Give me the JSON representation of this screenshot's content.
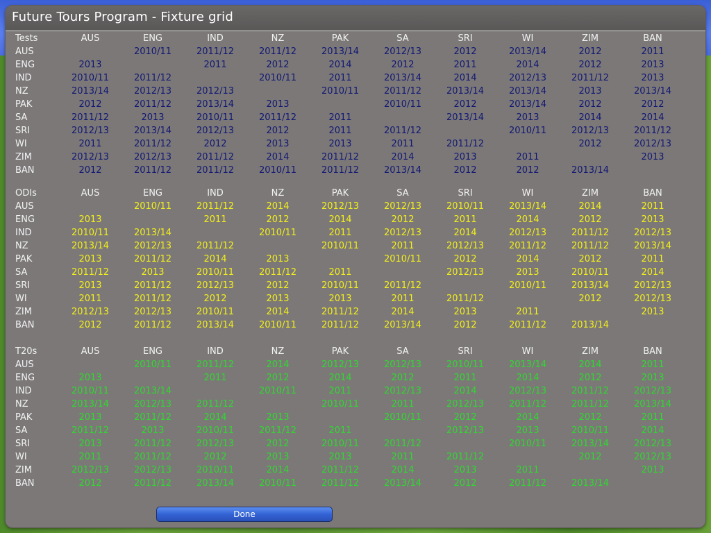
{
  "window": {
    "title": "Future Tours Program - Fixture grid"
  },
  "colors": {
    "tests": "#101873",
    "odis": "#f2ef1a",
    "t20s": "#2fd92f"
  },
  "teams": [
    "AUS",
    "ENG",
    "IND",
    "NZ",
    "PAK",
    "SA",
    "SRI",
    "WI",
    "ZIM",
    "BAN"
  ],
  "sections": [
    {
      "label": "Tests",
      "color_key": "tests",
      "rows": [
        [
          "",
          "2010/11",
          "2011/12",
          "2011/12",
          "2013/14",
          "2012/13",
          "2012",
          "2013/14",
          "2012",
          "2011"
        ],
        [
          "2013",
          "",
          "2011",
          "2012",
          "2014",
          "2012",
          "2011",
          "2014",
          "2012",
          "2013"
        ],
        [
          "2010/11",
          "2011/12",
          "",
          "2010/11",
          "2011",
          "2013/14",
          "2014",
          "2012/13",
          "2011/12",
          "2013"
        ],
        [
          "2013/14",
          "2012/13",
          "2012/13",
          "",
          "2010/11",
          "2011/12",
          "2013/14",
          "2013/14",
          "2013",
          "2013/14"
        ],
        [
          "2012",
          "2011/12",
          "2013/14",
          "2013",
          "",
          "2010/11",
          "2012",
          "2013/14",
          "2012",
          "2012"
        ],
        [
          "2011/12",
          "2013",
          "2010/11",
          "2011/12",
          "2011",
          "",
          "2013/14",
          "2013",
          "2014",
          "2014"
        ],
        [
          "2012/13",
          "2013/14",
          "2012/13",
          "2012",
          "2011",
          "2011/12",
          "",
          "2010/11",
          "2012/13",
          "2011/12"
        ],
        [
          "2011",
          "2011/12",
          "2012",
          "2013",
          "2013",
          "2011",
          "2011/12",
          "",
          "2012",
          "2012/13"
        ],
        [
          "2012/13",
          "2012/13",
          "2011/12",
          "2014",
          "2011/12",
          "2014",
          "2013",
          "2011",
          "",
          "2013"
        ],
        [
          "2012",
          "2011/12",
          "2011/12",
          "2010/11",
          "2011/12",
          "2013/14",
          "2012",
          "2012",
          "2013/14",
          ""
        ]
      ]
    },
    {
      "label": "ODIs",
      "color_key": "odis",
      "rows": [
        [
          "",
          "2010/11",
          "2011/12",
          "2014",
          "2012/13",
          "2012/13",
          "2010/11",
          "2013/14",
          "2014",
          "2011"
        ],
        [
          "2013",
          "",
          "2011",
          "2012",
          "2014",
          "2012",
          "2011",
          "2014",
          "2012",
          "2013"
        ],
        [
          "2010/11",
          "2013/14",
          "",
          "2010/11",
          "2011",
          "2012/13",
          "2014",
          "2012/13",
          "2011/12",
          "2012/13"
        ],
        [
          "2013/14",
          "2012/13",
          "2011/12",
          "",
          "2010/11",
          "2011",
          "2012/13",
          "2011/12",
          "2011/12",
          "2013/14"
        ],
        [
          "2013",
          "2011/12",
          "2014",
          "2013",
          "",
          "2010/11",
          "2012",
          "2014",
          "2012",
          "2011"
        ],
        [
          "2011/12",
          "2013",
          "2010/11",
          "2011/12",
          "2011",
          "",
          "2012/13",
          "2013",
          "2010/11",
          "2014"
        ],
        [
          "2013",
          "2011/12",
          "2012/13",
          "2012",
          "2010/11",
          "2011/12",
          "",
          "2010/11",
          "2013/14",
          "2012/13"
        ],
        [
          "2011",
          "2011/12",
          "2012",
          "2013",
          "2013",
          "2011",
          "2011/12",
          "",
          "2012",
          "2012/13"
        ],
        [
          "2012/13",
          "2012/13",
          "2010/11",
          "2014",
          "2011/12",
          "2014",
          "2013",
          "2011",
          "",
          "2013"
        ],
        [
          "2012",
          "2011/12",
          "2013/14",
          "2010/11",
          "2011/12",
          "2013/14",
          "2012",
          "2011/12",
          "2013/14",
          ""
        ]
      ]
    },
    {
      "label": "T20s",
      "color_key": "t20s",
      "rows": [
        [
          "",
          "2010/11",
          "2011/12",
          "2014",
          "2012/13",
          "2012/13",
          "2010/11",
          "2013/14",
          "2014",
          "2011"
        ],
        [
          "2013",
          "",
          "2011",
          "2012",
          "2014",
          "2012",
          "2011",
          "2014",
          "2012",
          "2013"
        ],
        [
          "2010/11",
          "2013/14",
          "",
          "2010/11",
          "2011",
          "2012/13",
          "2014",
          "2012/13",
          "2011/12",
          "2012/13"
        ],
        [
          "2013/14",
          "2012/13",
          "2011/12",
          "",
          "2010/11",
          "2011",
          "2012/13",
          "2011/12",
          "2011/12",
          "2013/14"
        ],
        [
          "2013",
          "2011/12",
          "2014",
          "2013",
          "",
          "2010/11",
          "2012",
          "2014",
          "2012",
          "2011"
        ],
        [
          "2011/12",
          "2013",
          "2010/11",
          "2011/12",
          "2011",
          "",
          "2012/13",
          "2013",
          "2010/11",
          "2014"
        ],
        [
          "2013",
          "2011/12",
          "2012/13",
          "2012",
          "2010/11",
          "2011/12",
          "",
          "2010/11",
          "2013/14",
          "2012/13"
        ],
        [
          "2011",
          "2011/12",
          "2012",
          "2013",
          "2013",
          "2011",
          "2011/12",
          "",
          "2012",
          "2012/13"
        ],
        [
          "2012/13",
          "2012/13",
          "2010/11",
          "2014",
          "2011/12",
          "2014",
          "2013",
          "2011",
          "",
          "2013"
        ],
        [
          "2012",
          "2011/12",
          "2013/14",
          "2010/11",
          "2011/12",
          "2013/14",
          "2012",
          "2011/12",
          "2013/14",
          ""
        ]
      ]
    }
  ],
  "footer": {
    "done_label": "Done"
  }
}
